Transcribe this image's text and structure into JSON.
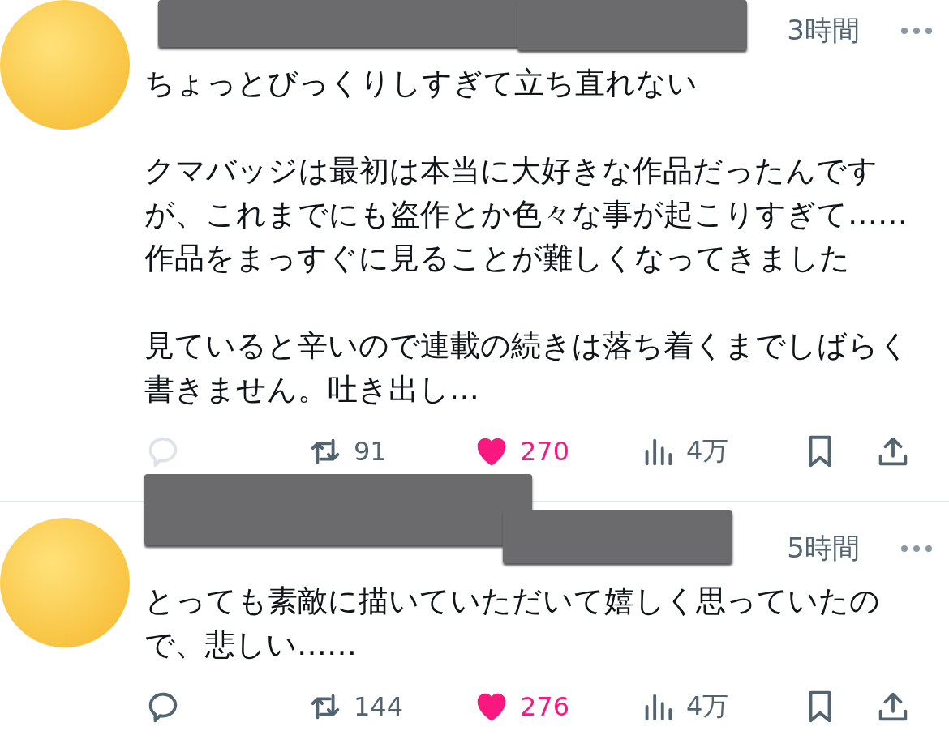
{
  "posts": [
    {
      "time": "3時間",
      "paragraphs": [
        "ちょっとびっくりしすぎて立ち直れない",
        "クマバッジは最初は本当に大好きな作品だったんですが、これまでにも盗作とか色々な事が起こりすぎて……作品をまっすぐに見ることが難しくなってきました",
        "見ていると辛いので連載の続きは落ち着くまでしばらく書きません。吐き出し…"
      ],
      "reply_disabled": true,
      "retweets": "91",
      "likes": "270",
      "liked": true,
      "views": "4万"
    },
    {
      "time": "5時間",
      "paragraphs": [
        "とっても素敵に描いていただいて嬉しく思っていたので、悲しい……"
      ],
      "reply_disabled": false,
      "retweets": "144",
      "likes": "276",
      "liked": true,
      "views": "4万"
    }
  ]
}
